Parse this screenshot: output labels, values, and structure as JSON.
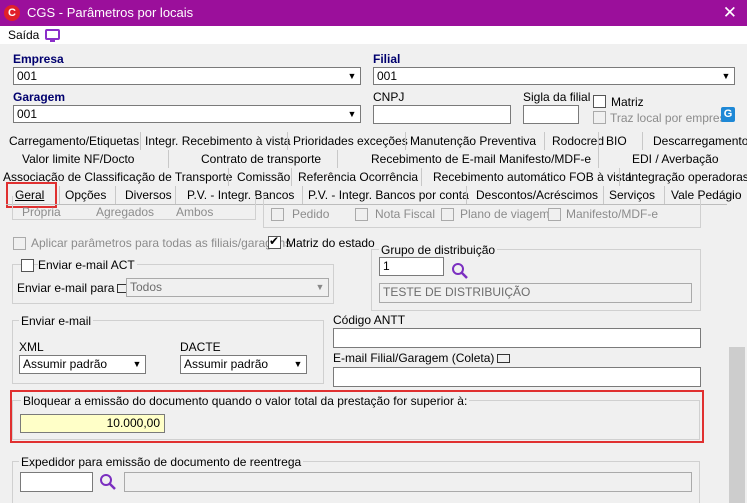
{
  "window": {
    "title": "CGS - Parâmetros por locais"
  },
  "menu": {
    "saida": "Saída"
  },
  "empresa": {
    "label": "Empresa",
    "value": "001"
  },
  "filial": {
    "label": "Filial",
    "value": "001"
  },
  "garagem": {
    "label": "Garagem",
    "value": "001"
  },
  "cnpj": {
    "label": "CNPJ",
    "value": ""
  },
  "sigla": {
    "label": "Sigla da filial",
    "value": ""
  },
  "matriz": {
    "label": "Matriz",
    "checked": false
  },
  "traz_local": {
    "label": "Traz local por empresa",
    "checked": false
  },
  "tabs": {
    "row1": [
      "Carregamento/Etiquetas",
      "Integr. Recebimento à vista",
      "Prioridades exceções",
      "Manutenção Preventiva",
      "Rodocred",
      "BIO",
      "Descarregamento"
    ],
    "row2": [
      "Valor limite NF/Docto",
      "Contrato de transporte",
      "Recebimento de E-mail Manifesto/MDF-e",
      "EDI / Averbação"
    ],
    "row3": [
      "Associação de Classificação de Transporte",
      "Comissão",
      "Referência Ocorrência",
      "Recebimento automático FOB à vista",
      "Integração operadoras"
    ],
    "row4": [
      "Geral",
      "Opções",
      "Diversos",
      "P.V. - Integr. Bancos",
      "P.V. - Integr. Bancos por conta",
      "Descontos/Acréscimos",
      "Serviços",
      "Vale Pedágio"
    ]
  },
  "partial_row": {
    "r1": "Própria",
    "r2": "Agregados",
    "r3": "Ambos",
    "c1": "Pedido",
    "c2": "Nota Fiscal",
    "c3": "Plano de viagem",
    "c4": "Manifesto/MDF-e"
  },
  "aplicar": {
    "label": "Aplicar parâmetros para todas as filiais/garagens",
    "checked": false
  },
  "matriz_estado": {
    "label": "Matriz do estado",
    "checked": true
  },
  "grupo_dist": {
    "label": "Grupo de distribuição",
    "code": "1",
    "name": "TESTE DE DISTRIBUIÇÃO"
  },
  "email_act": {
    "label": "Enviar e-mail ACT",
    "checked": false,
    "para_label": "Enviar e-mail para",
    "para_value": "Todos"
  },
  "enviar_email": {
    "label": "Enviar e-mail",
    "xml_label": "XML",
    "xml_value": "Assumir padrão",
    "dacte_label": "DACTE",
    "dacte_value": "Assumir padrão"
  },
  "codigo_antt": {
    "label": "Código ANTT",
    "value": ""
  },
  "email_filial": {
    "label": "E-mail Filial/Garagem (Coleta)",
    "value": ""
  },
  "bloquear": {
    "label": "Bloquear a emissão do documento quando o valor total da prestação for superior à:",
    "value": "10.000,00"
  },
  "expedidor": {
    "label": "Expedidor para emissão de documento de reentrega",
    "code": "",
    "name": ""
  },
  "colors": {
    "titlebar": "#9b0f9b",
    "accent_label": "#00006e",
    "highlight": "#e03030",
    "value_field": "#ffffc8"
  },
  "icons": {
    "app": "cgs-logo-icon",
    "close": "close-icon",
    "monitor": "monitor-icon",
    "search": "search-icon",
    "dropdown": "chevron-down-icon"
  }
}
